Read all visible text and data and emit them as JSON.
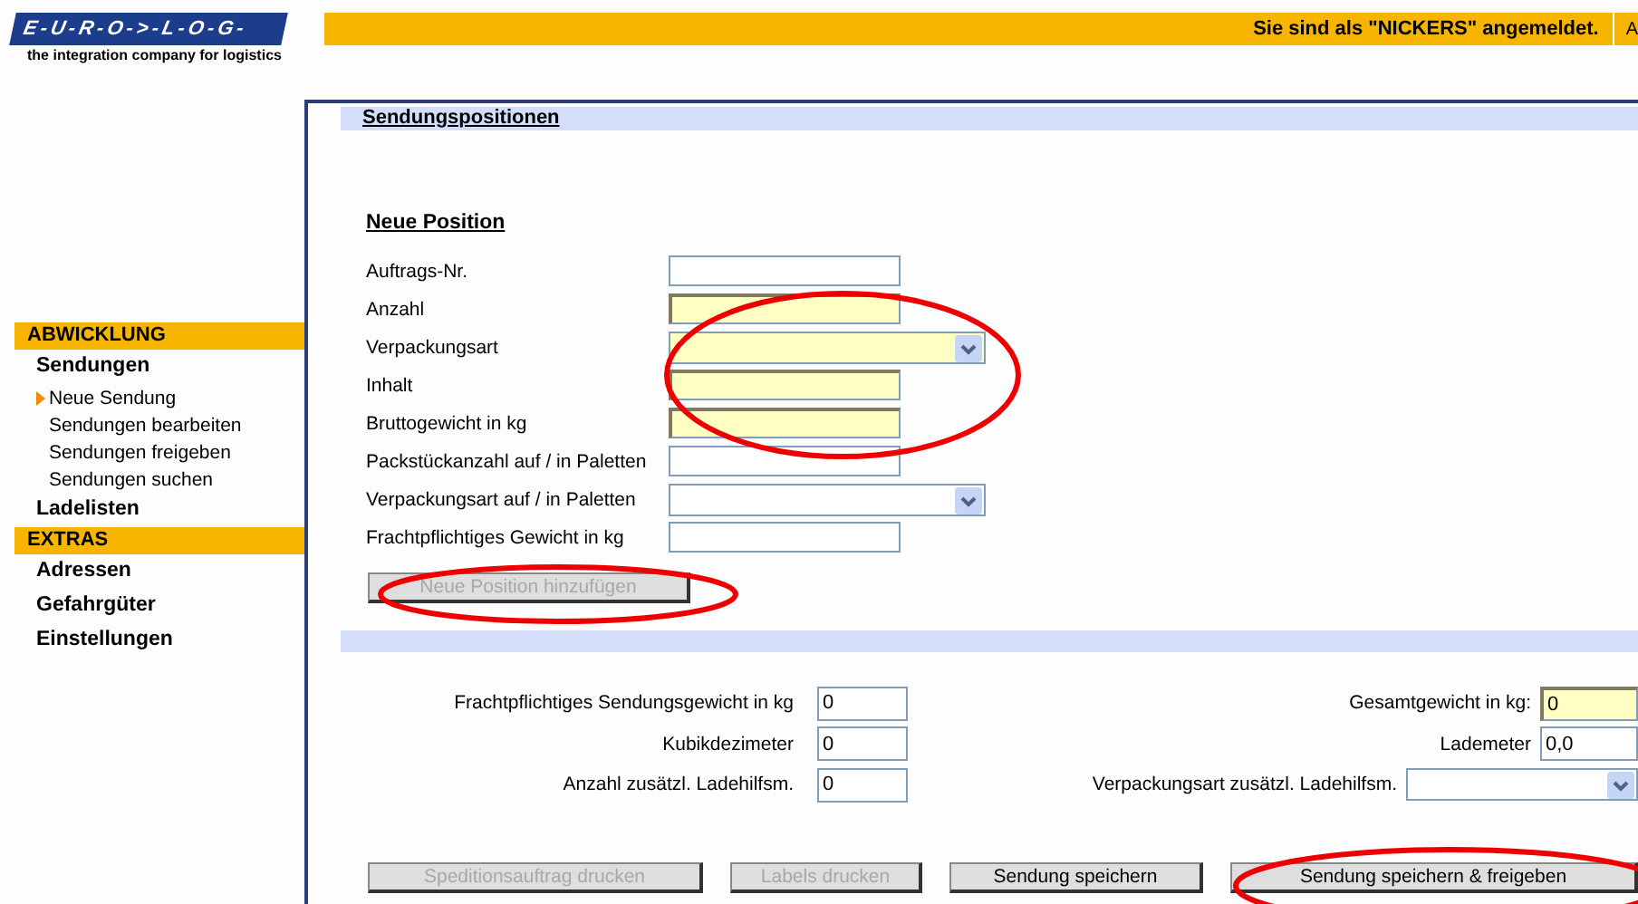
{
  "header": {
    "logo": "E-U-R-O->-L-O-G-",
    "tagline": "the integration company for logistics",
    "login_status": "Sie sind als \"NICKERS\" angemeldet.",
    "cut_item": "A"
  },
  "sidebar": [
    {
      "kind": "section",
      "label": "ABWICKLUNG"
    },
    {
      "kind": "group",
      "label": "Sendungen"
    },
    {
      "kind": "link",
      "label": "Neue Sendung",
      "selected": true
    },
    {
      "kind": "link",
      "label": "Sendungen bearbeiten",
      "selected": false
    },
    {
      "kind": "link",
      "label": "Sendungen freigeben",
      "selected": false
    },
    {
      "kind": "link",
      "label": "Sendungen suchen",
      "selected": false
    },
    {
      "kind": "group",
      "label": "Ladelisten"
    },
    {
      "kind": "section",
      "label": "EXTRAS"
    },
    {
      "kind": "group",
      "label": "Adressen"
    },
    {
      "kind": "group",
      "label": "Gefahrgüter"
    },
    {
      "kind": "group",
      "label": "Einstellungen"
    }
  ],
  "panel_title": "Sendungspositionen",
  "form_title": "Neue Position",
  "position_fields": [
    {
      "label": "Auftrags-Nr.",
      "kind": "text",
      "required": false
    },
    {
      "label": "Anzahl",
      "kind": "text",
      "required": true
    },
    {
      "label": "Verpackungsart",
      "kind": "select",
      "required": true
    },
    {
      "label": "Inhalt",
      "kind": "text",
      "required": true
    },
    {
      "label": "Bruttogewicht in kg",
      "kind": "text",
      "required": true
    },
    {
      "label": "Packstückanzahl auf / in Paletten",
      "kind": "text",
      "required": false
    },
    {
      "label": "Verpackungsart auf / in Paletten",
      "kind": "select",
      "required": false
    },
    {
      "label": "Frachtpflichtiges Gewicht in kg",
      "kind": "text",
      "required": false
    }
  ],
  "add_button": {
    "label": "Neue Position hinzufügen",
    "disabled": true
  },
  "summary_left": [
    {
      "label": "Frachtpflichtiges Sendungsgewicht in kg",
      "value": "0"
    },
    {
      "label": "Kubikdezimeter",
      "value": "0"
    },
    {
      "label": "Anzahl zusätzl. Ladehilfsm.",
      "value": "0"
    }
  ],
  "summary_right": [
    {
      "label": "Gesamtgewicht in kg:",
      "kind": "text",
      "value": "0",
      "required": true
    },
    {
      "label": "Lademeter",
      "kind": "text",
      "value": "0,0",
      "required": false
    },
    {
      "label": "Verpackungsart zusätzl. Ladehilfsm.",
      "kind": "select",
      "required": false
    }
  ],
  "buttons": [
    {
      "label": "Speditionsauftrag drucken",
      "disabled": true
    },
    {
      "label": "Labels drucken",
      "disabled": true
    },
    {
      "label": "Sendung speichern",
      "disabled": false
    },
    {
      "label": "Sendung speichern & freigeben",
      "disabled": false
    }
  ]
}
